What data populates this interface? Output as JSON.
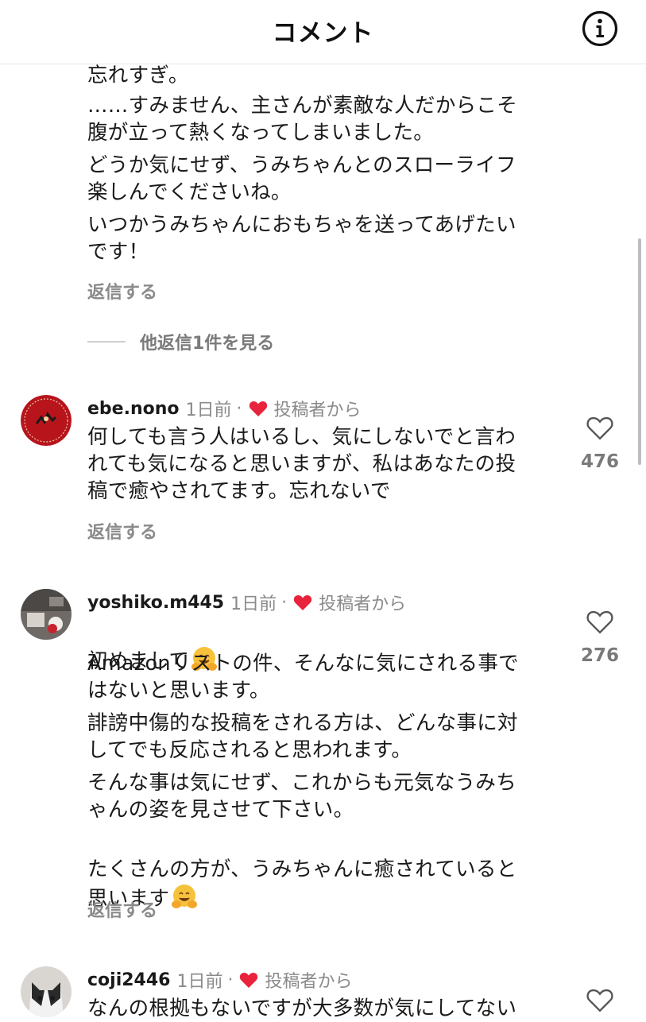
{
  "header": {
    "title": "コメント",
    "info_icon": "info-circle-icon"
  },
  "thread_top": {
    "paragraphs": [
      "忘れすぎ。",
      "……すみません、主さんが素敵な人だからこそ\n腹が立って熱くなってしまいました。",
      "どうか気にせず、うみちゃんとのスローライフ\n楽しんでくださいね。",
      "いつかうみちゃんにおもちゃを送ってあげたい\nです！"
    ],
    "reply_label": "返信する",
    "more_replies_label": "他返信1件を見る"
  },
  "comments": [
    {
      "username": "ebe.nono",
      "time": "1日前",
      "creator_label": "投稿者から",
      "paragraphs": [
        "何しても言う人はいるし、気にしないでと言わ\nれても気になると思いますが、私はあなたの投\n稿で癒やされてます。忘れないで"
      ],
      "reply_label": "返信する",
      "likes": "476"
    },
    {
      "username": "yoshiko.m445",
      "time": "1日前",
      "creator_label": "投稿者から",
      "paragraphs": [
        "初めまして",
        "Amazonリストの件、そんなに気にされる事で\nはないと思います。",
        "誹謗中傷的な投稿をされる方は、どんな事に対\nしてでも反応されると思われます。",
        "そんな事は気にせず、これからも元気なうみち\nゃんの姿を見させて下さい。",
        "たくさんの方が、うみちゃんに癒されていると\n思います"
      ],
      "reply_label": "返信する",
      "likes": "276"
    },
    {
      "username": "coji2446",
      "time": "1日前",
      "creator_label": "投稿者から",
      "paragraphs": [
        "なんの根拠もないですが大多数が気にしてない"
      ],
      "likes": ""
    }
  ],
  "colors": {
    "heart_red": "#e8233b",
    "muted": "#8a8a8a",
    "emoji_yellow": "#f7c23b"
  }
}
